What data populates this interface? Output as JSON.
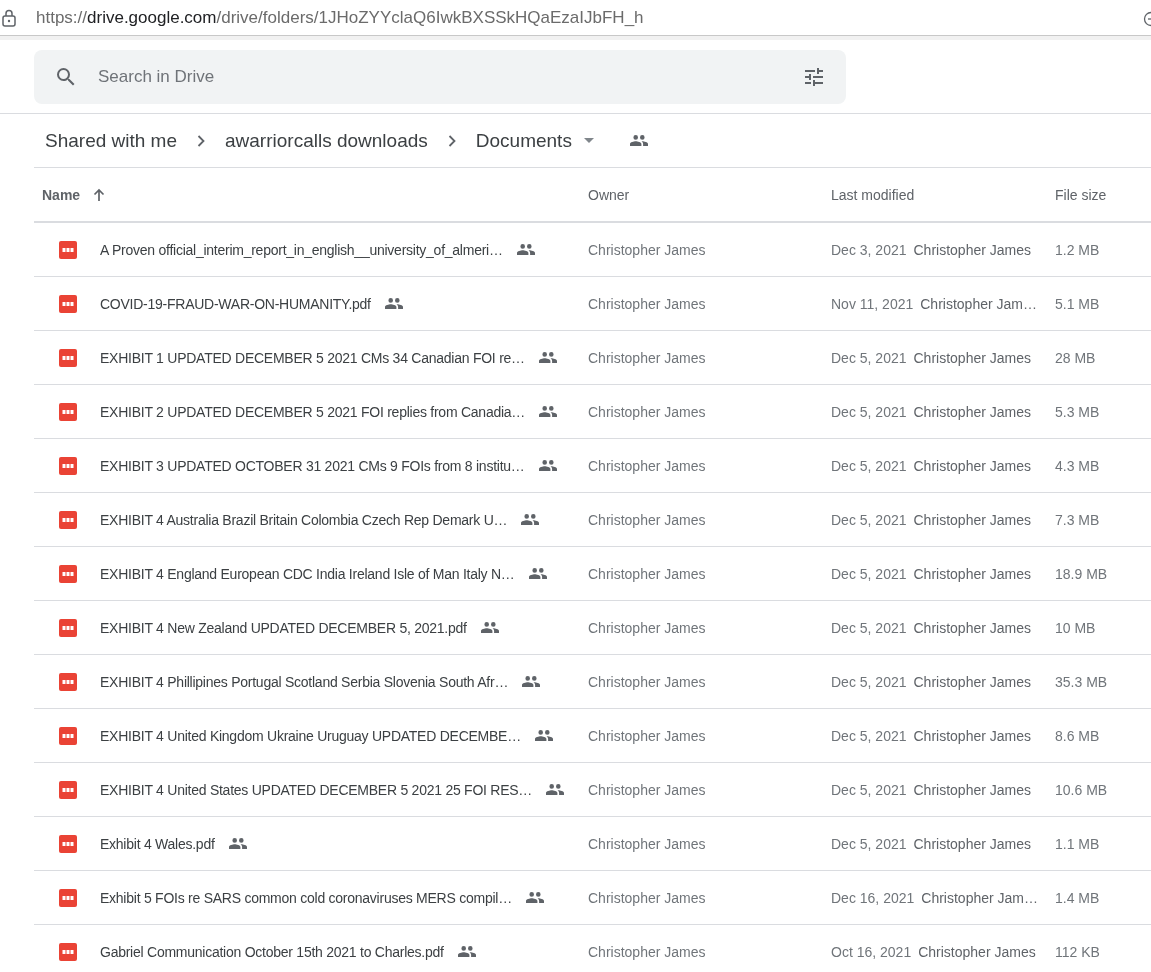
{
  "address_bar": {
    "scheme": "https://",
    "host": "drive.google.com",
    "path": "/drive/folders/1JHoZYYclaQ6IwkBXSSkHQaEzaIJbFH_h"
  },
  "search": {
    "placeholder": "Search in Drive"
  },
  "breadcrumb": {
    "items": [
      "Shared with me",
      "awarriorcalls downloads",
      "Documents"
    ],
    "shared": true
  },
  "table": {
    "columns": [
      {
        "label": "Name",
        "sorted_ascending": true
      },
      {
        "label": "Owner"
      },
      {
        "label": "Last modified"
      },
      {
        "label": "File size"
      }
    ],
    "rows": [
      {
        "name": "A Proven official_interim_report_in_english__university_of_almeri…",
        "shared": true,
        "owner": "Christopher James",
        "modified": "Dec 3, 2021",
        "modified_by": "Christopher James",
        "size": "1.2 MB"
      },
      {
        "name": "COVID-19-FRAUD-WAR-ON-HUMANITY.pdf",
        "shared": true,
        "owner": "Christopher James",
        "modified": "Nov 11, 2021",
        "modified_by": "Christopher Jam…",
        "size": "5.1 MB"
      },
      {
        "name": "EXHIBIT 1 UPDATED DECEMBER 5 2021 CMs 34 Canadian FOI re…",
        "shared": true,
        "owner": "Christopher James",
        "modified": "Dec 5, 2021",
        "modified_by": "Christopher James",
        "size": "28 MB"
      },
      {
        "name": "EXHIBIT 2 UPDATED DECEMBER 5 2021 FOI replies from Canadia…",
        "shared": true,
        "owner": "Christopher James",
        "modified": "Dec 5, 2021",
        "modified_by": "Christopher James",
        "size": "5.3 MB"
      },
      {
        "name": "EXHIBIT 3 UPDATED OCTOBER 31 2021 CMs 9 FOIs from 8 institu…",
        "shared": true,
        "owner": "Christopher James",
        "modified": "Dec 5, 2021",
        "modified_by": "Christopher James",
        "size": "4.3 MB"
      },
      {
        "name": "EXHIBIT 4 Australia Brazil Britain Colombia Czech Rep Demark U…",
        "shared": true,
        "owner": "Christopher James",
        "modified": "Dec 5, 2021",
        "modified_by": "Christopher James",
        "size": "7.3 MB"
      },
      {
        "name": "EXHIBIT 4 England European CDC India Ireland Isle of Man Italy N…",
        "shared": true,
        "owner": "Christopher James",
        "modified": "Dec 5, 2021",
        "modified_by": "Christopher James",
        "size": "18.9 MB"
      },
      {
        "name": "EXHIBIT 4 New Zealand UPDATED DECEMBER 5, 2021.pdf",
        "shared": true,
        "owner": "Christopher James",
        "modified": "Dec 5, 2021",
        "modified_by": "Christopher James",
        "size": "10 MB"
      },
      {
        "name": "EXHIBIT 4 Phillipines Portugal Scotland Serbia Slovenia South Afr…",
        "shared": true,
        "owner": "Christopher James",
        "modified": "Dec 5, 2021",
        "modified_by": "Christopher James",
        "size": "35.3 MB"
      },
      {
        "name": "EXHIBIT 4 United Kingdom Ukraine Uruguay UPDATED DECEMBE…",
        "shared": true,
        "owner": "Christopher James",
        "modified": "Dec 5, 2021",
        "modified_by": "Christopher James",
        "size": "8.6 MB"
      },
      {
        "name": "EXHIBIT 4 United States UPDATED DECEMBER 5 2021 25 FOI RES…",
        "shared": true,
        "owner": "Christopher James",
        "modified": "Dec 5, 2021",
        "modified_by": "Christopher James",
        "size": "10.6 MB"
      },
      {
        "name": "Exhibit 4 Wales.pdf",
        "shared": true,
        "owner": "Christopher James",
        "modified": "Dec 5, 2021",
        "modified_by": "Christopher James",
        "size": "1.1 MB"
      },
      {
        "name": "Exhibit 5 FOIs re SARS common cold coronaviruses MERS compil…",
        "shared": true,
        "owner": "Christopher James",
        "modified": "Dec 16, 2021",
        "modified_by": "Christopher Jam…",
        "size": "1.4 MB"
      },
      {
        "name": "Gabriel Communication October 15th 2021 to Charles.pdf",
        "shared": true,
        "owner": "Christopher James",
        "modified": "Oct 16, 2021",
        "modified_by": "Christopher James",
        "size": "112 KB"
      }
    ]
  }
}
